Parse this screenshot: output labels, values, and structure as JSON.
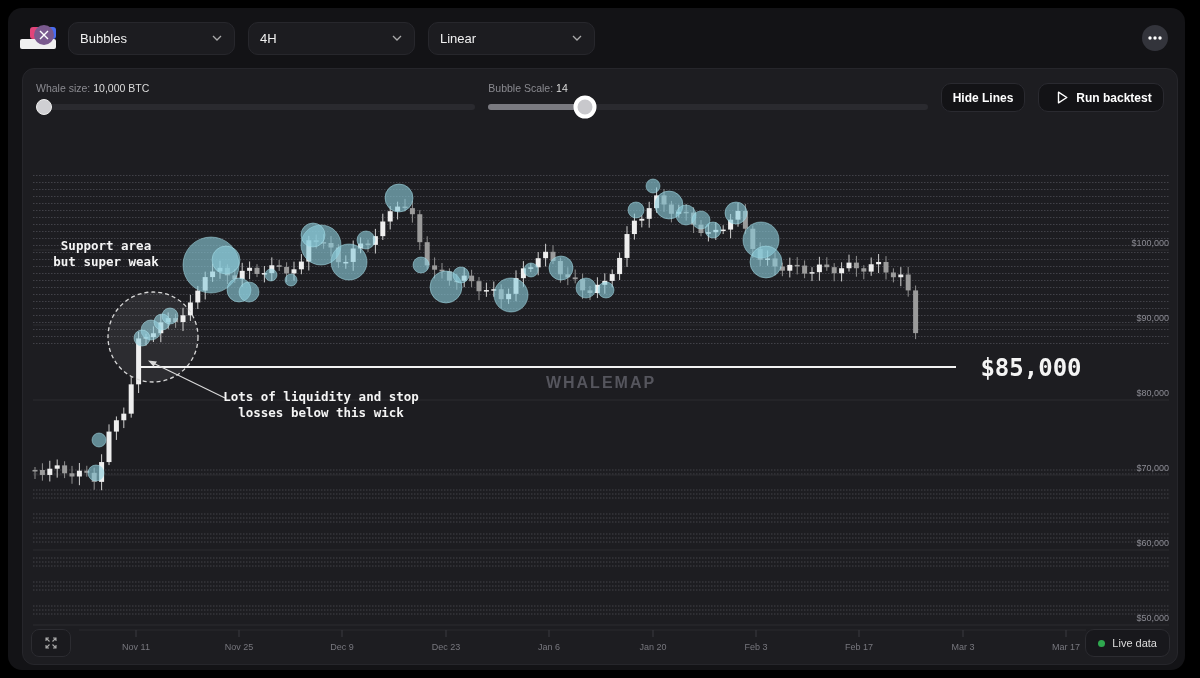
{
  "toolbar": {
    "selects": [
      {
        "value": "Bubbles"
      },
      {
        "value": "4H"
      },
      {
        "value": "Linear"
      }
    ]
  },
  "controls": {
    "sliders": [
      {
        "label": "Whale size:",
        "value": "10,000 BTC",
        "level": 0,
        "focused": false
      },
      {
        "label": "Bubble Scale:",
        "value": "14",
        "level": 0.21,
        "focused": true
      }
    ],
    "buttons": [
      {
        "kind": "plain",
        "label": "Hide Lines"
      },
      {
        "kind": "play",
        "label": "Run backtest"
      }
    ]
  },
  "chart": {
    "watermark": "WHALEMAP",
    "y_axis": [
      "$100,000",
      "$90,000",
      "$80,000",
      "$70,000",
      "$60,000",
      "$50,000"
    ],
    "x_axis": [
      "Nov 11",
      "Nov 25",
      "Dec 9",
      "Dec 23",
      "Jan 6",
      "Jan 20",
      "Feb 3",
      "Feb 17",
      "Mar 3",
      "Mar 17"
    ],
    "annotations": [
      {
        "kind": "note",
        "lines": [
          "Support area",
          "but super weak"
        ]
      },
      {
        "kind": "note",
        "lines": [
          "Lots of liquidity and stop",
          "losses below this wick"
        ]
      },
      {
        "kind": "price",
        "lines": [
          "$85,000"
        ]
      }
    ]
  },
  "live_button": {
    "label": "Live data",
    "live": true
  }
}
